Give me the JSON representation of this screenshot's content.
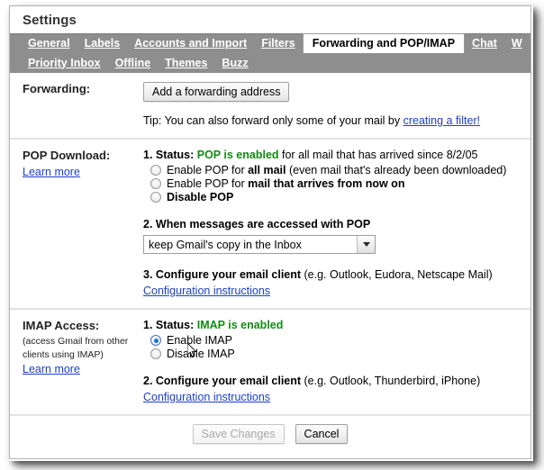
{
  "window": {
    "title": "Settings"
  },
  "tabs": {
    "row1": [
      {
        "label": "General",
        "active": false
      },
      {
        "label": "Labels",
        "active": false
      },
      {
        "label": "Accounts and Import",
        "active": false
      },
      {
        "label": "Filters",
        "active": false
      },
      {
        "label": "Forwarding and POP/IMAP",
        "active": true
      },
      {
        "label": "Chat",
        "active": false
      },
      {
        "label": "W",
        "active": false,
        "clipped": true
      }
    ],
    "row2": [
      {
        "label": "Priority Inbox"
      },
      {
        "label": "Offline"
      },
      {
        "label": "Themes"
      },
      {
        "label": "Buzz"
      }
    ]
  },
  "forwarding": {
    "label": "Forwarding:",
    "add_button": "Add a forwarding address",
    "tip_prefix": "Tip: You can also forward only some of your mail by ",
    "tip_link": "creating a filter!"
  },
  "pop": {
    "label": "POP Download:",
    "learn_more": "Learn more",
    "step1_prefix": "1. Status: ",
    "step1_status": "POP is enabled",
    "step1_suffix": " for all mail that has arrived since 8/2/05",
    "options": [
      {
        "pre": "Enable POP for ",
        "bold": "all mail",
        "post": " (even mail that's already been downloaded)",
        "checked": false
      },
      {
        "pre": "Enable POP for ",
        "bold": "mail that arrives from now on",
        "post": "",
        "checked": false
      },
      {
        "pre": "",
        "bold": "Disable POP",
        "post": "",
        "checked": false
      }
    ],
    "step2": "2. When messages are accessed with POP",
    "select_value": "keep Gmail's copy in the Inbox",
    "step3_bold": "3. Configure your email client",
    "step3_normal": " (e.g. Outlook, Eudora, Netscape Mail)",
    "config_link": "Configuration instructions"
  },
  "imap": {
    "label": "IMAP Access:",
    "sub_line1": "(access Gmail from other",
    "sub_line2": "clients using IMAP)",
    "learn_more": "Learn more",
    "step1_prefix": "1. Status: ",
    "step1_status": "IMAP is enabled",
    "options": [
      {
        "label": "Enable IMAP",
        "checked": true
      },
      {
        "label": "Disable IMAP",
        "checked": false
      }
    ],
    "step2_bold": "2. Configure your email client",
    "step2_normal": " (e.g. Outlook, Thunderbird, iPhone)",
    "config_link": "Configuration instructions"
  },
  "footer": {
    "save": "Save Changes",
    "cancel": "Cancel"
  },
  "colors": {
    "tabbar": "#8e8e8e",
    "status_green": "#128b12",
    "link_blue": "#1b3fcc",
    "divider": "#e2e2e8"
  }
}
